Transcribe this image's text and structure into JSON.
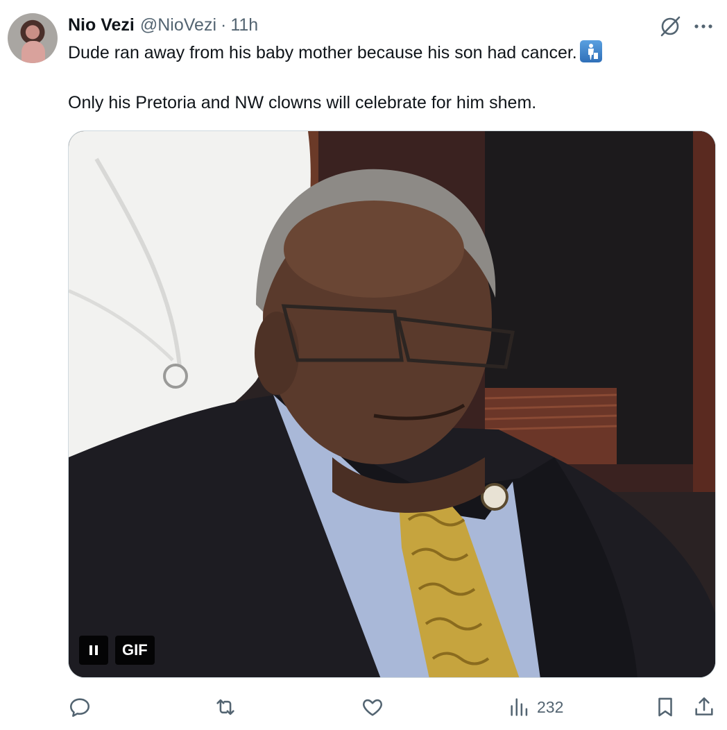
{
  "author": {
    "display_name": "Nio Vezi",
    "handle": "@NioVezi",
    "separator": "·",
    "time": "11h",
    "avatar_icon": "avatar-photo"
  },
  "tweet": {
    "line1": "Dude ran away from his baby mother because his son had cancer.",
    "line1_emoji": "put-litter-in-its-place-emoji",
    "line2": "Only his Pretoria and NW clowns will celebrate for him shem."
  },
  "media": {
    "type": "gif",
    "gif_label": "GIF",
    "pause_icon": "pause-icon"
  },
  "actions": {
    "reply_icon": "reply-icon",
    "retweet_icon": "retweet-icon",
    "like_icon": "heart-icon",
    "views_icon": "views-chart-icon",
    "views_count": "232",
    "bookmark_icon": "bookmark-icon",
    "share_icon": "share-icon"
  },
  "header_icons": {
    "grok": "grok-icon",
    "more": "more-dots-icon"
  },
  "colors": {
    "text_primary": "#0f1419",
    "text_secondary": "#536471",
    "border": "#cfd9de"
  }
}
